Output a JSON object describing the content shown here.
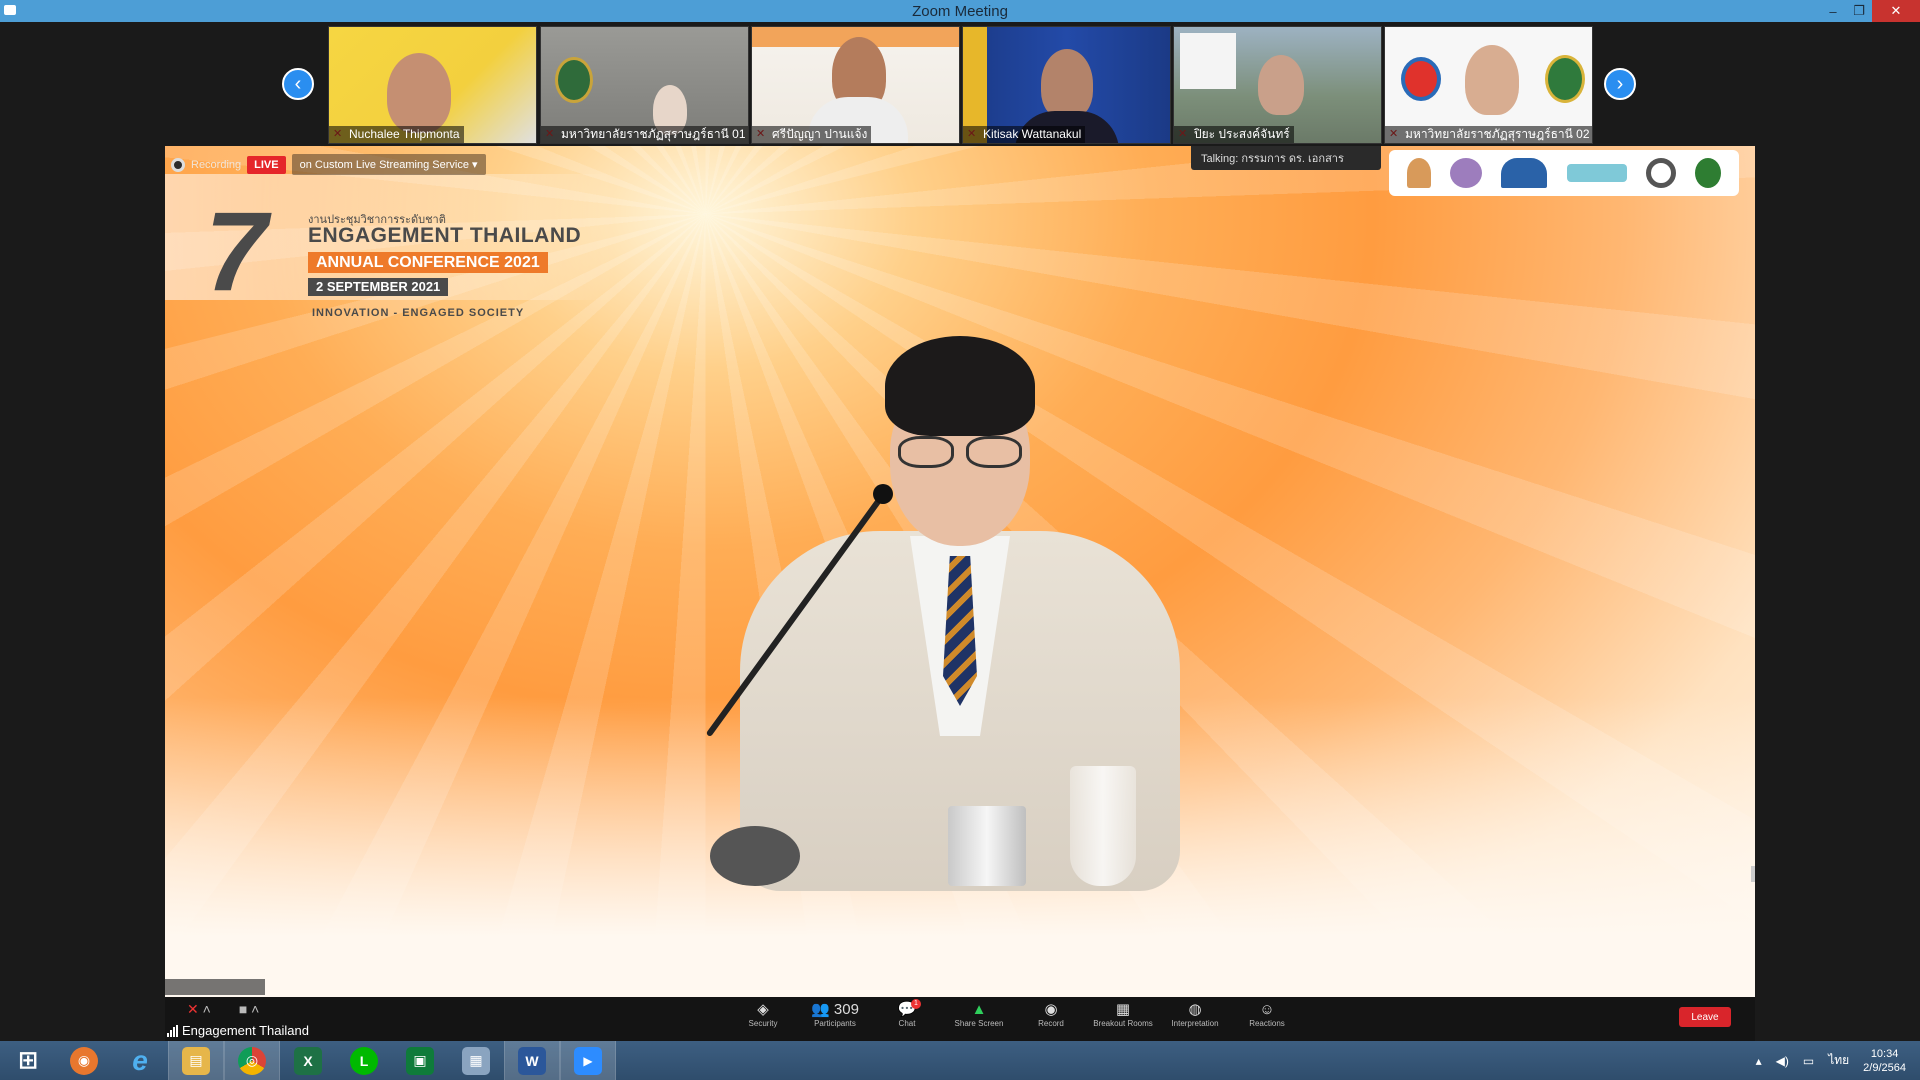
{
  "window": {
    "title": "Zoom Meeting",
    "controls": {
      "minimize": "–",
      "restore": "❐",
      "close": "✕"
    }
  },
  "video_strip": {
    "prev_arrow": "‹",
    "next_arrow": "›",
    "tiles": [
      {
        "name": "Nuchalee Thipmonta",
        "bg": "#f3d03e"
      },
      {
        "name": "มหาวิทยาลัยราชภัฏสุราษฎร์ธานี 01",
        "bg": "#8a8a86"
      },
      {
        "name": "ศรีปัญญา ปานแจ้ง",
        "bg": "#f2a45a"
      },
      {
        "name": "Kitisak Wattanakul",
        "bg": "#1f3f8f"
      },
      {
        "name": "ปิยะ ประสงค์จันทร์",
        "bg": "#7c8f7a"
      },
      {
        "name": "มหาวิทยาลัยราชภัฏสุราษฎร์ธานี 02",
        "bg": "#f5f5f5"
      }
    ]
  },
  "stage": {
    "recording_label": "Recording",
    "live_label": "LIVE",
    "stream_label": "on Custom Live Streaming Service ▾",
    "tooltip": "Talking: กรรมการ ดร. เอกสาร",
    "conference": {
      "number": "7",
      "thai_line": "งานประชุมวิชาการระดับชาติ",
      "title": "ENGAGEMENT THAILAND",
      "annual": "ANNUAL CONFERENCE 2021",
      "date": "2 SEPTEMBER 2021",
      "tagline": "INNOVATION - ENGAGED SOCIETY"
    }
  },
  "toolbar": {
    "self_name": "Engagement Thailand",
    "buttons": [
      {
        "label": "Security",
        "icon": "◈"
      },
      {
        "label": "Participants",
        "icon": "👥 309"
      },
      {
        "label": "Chat",
        "icon": "💬"
      },
      {
        "label": "Share Screen",
        "icon": "▲"
      },
      {
        "label": "Record",
        "icon": "◉"
      },
      {
        "label": "Breakout Rooms",
        "icon": "▦"
      },
      {
        "label": "Interpretation",
        "icon": "◍"
      },
      {
        "label": "Reactions",
        "icon": "☺"
      }
    ],
    "chat_badge": "1",
    "leave_label": "Leave"
  },
  "taskbar": {
    "apps": [
      {
        "name": "start",
        "glyph": "⊞",
        "color": ""
      },
      {
        "name": "firefox",
        "glyph": "◉",
        "color": "#e8772e"
      },
      {
        "name": "ie",
        "glyph": "e",
        "color": "#2b7cd3"
      },
      {
        "name": "explorer",
        "glyph": "▤",
        "color": "#e6b64a"
      },
      {
        "name": "chrome",
        "glyph": "◎",
        "color": "#db4437"
      },
      {
        "name": "excel",
        "glyph": "X",
        "color": "#1e7145"
      },
      {
        "name": "line",
        "glyph": "L",
        "color": "#00b900"
      },
      {
        "name": "store",
        "glyph": "▣",
        "color": "#0f7b3a"
      },
      {
        "name": "calculator",
        "glyph": "▦",
        "color": "#8aa4c0"
      },
      {
        "name": "word",
        "glyph": "W",
        "color": "#2b579a"
      },
      {
        "name": "zoom",
        "glyph": "▶",
        "color": "#2d8cff"
      }
    ],
    "tray_lang": "ไทย",
    "time": "10:34",
    "date": "2/9/2564"
  }
}
